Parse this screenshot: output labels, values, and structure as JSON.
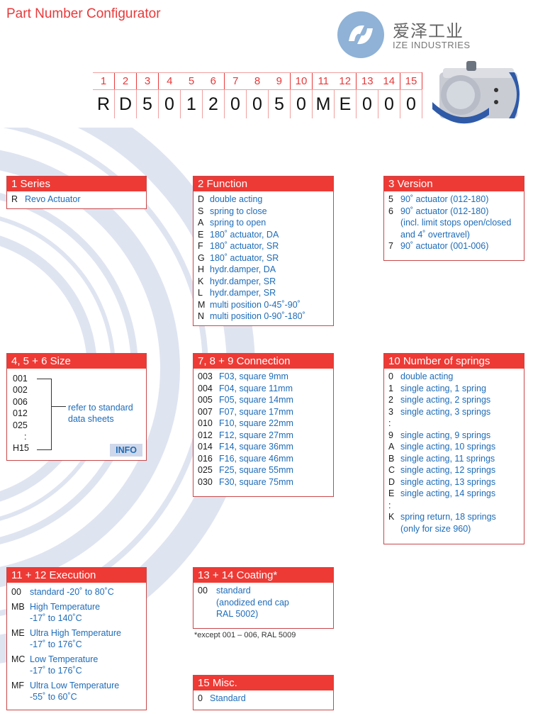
{
  "title": "Part Number Configurator",
  "logo": {
    "chinese": "爱泽工业",
    "english": "IZE INDUSTRIES"
  },
  "code": {
    "positions": [
      "1",
      "2",
      "3",
      "4",
      "5",
      "6",
      "7",
      "8",
      "9",
      "10",
      "11",
      "12",
      "13",
      "14",
      "15"
    ],
    "values": [
      "R",
      "D",
      "5",
      "0",
      "1",
      "2",
      "0",
      "0",
      "5",
      "0",
      "M",
      "E",
      "0",
      "0",
      "0"
    ]
  },
  "series": {
    "header": "1  Series",
    "items": [
      {
        "code": "R",
        "desc": "Revo Actuator"
      }
    ]
  },
  "function": {
    "header": "2  Function",
    "items": [
      {
        "code": "D",
        "desc": "double acting"
      },
      {
        "code": "S",
        "desc": "spring to close"
      },
      {
        "code": "A",
        "desc": "spring to open"
      },
      {
        "code": "E",
        "desc": "180˚ actuator, DA"
      },
      {
        "code": "F",
        "desc": "180˚ actuator, SR"
      },
      {
        "code": "G",
        "desc": "180˚ actuator, SR"
      },
      {
        "code": "H",
        "desc": "hydr.damper, DA"
      },
      {
        "code": "K",
        "desc": "hydr.damper, SR"
      },
      {
        "code": "L",
        "desc": "hydr.damper, SR"
      },
      {
        "code": "M",
        "desc": "multi position 0-45˚-90˚"
      },
      {
        "code": "N",
        "desc": "multi position 0-90˚-180˚"
      }
    ]
  },
  "version": {
    "header": "3  Version",
    "items": [
      {
        "code": "5",
        "desc": "90˚ actuator (012-180)"
      },
      {
        "code": "6",
        "desc": "90˚ actuator (012-180)",
        "extra": [
          "(incl. limit stops open/closed",
          "and 4˚ overtravel)"
        ]
      },
      {
        "code": "7",
        "desc": "90˚ actuator (001-006)"
      }
    ]
  },
  "size": {
    "header": "4, 5 + 6  Size",
    "items": [
      "001",
      "002",
      "006",
      "012",
      "025",
      ":",
      "H15"
    ],
    "reference": [
      "refer to standard",
      "data sheets"
    ],
    "info_label": "INFO"
  },
  "connection": {
    "header": "7, 8 + 9  Connection",
    "items": [
      {
        "code": "003",
        "desc": "F03, square 9mm"
      },
      {
        "code": "004",
        "desc": "F04, square 11mm"
      },
      {
        "code": "005",
        "desc": "F05, square 14mm"
      },
      {
        "code": "007",
        "desc": "F07, square 17mm"
      },
      {
        "code": "010",
        "desc": "F10, square 22mm"
      },
      {
        "code": "012",
        "desc": "F12, square 27mm"
      },
      {
        "code": "014",
        "desc": "F14, square 36mm"
      },
      {
        "code": "016",
        "desc": "F16, square 46mm"
      },
      {
        "code": "025",
        "desc": "F25, square 55mm"
      },
      {
        "code": "030",
        "desc": "F30, square 75mm"
      }
    ]
  },
  "springs": {
    "header": "10  Number of springs",
    "items": [
      {
        "code": "0",
        "desc": "double acting"
      },
      {
        "code": "1",
        "desc": "single acting, 1 spring"
      },
      {
        "code": "2",
        "desc": "single acting, 2 springs"
      },
      {
        "code": "3",
        "desc": "single acting, 3 springs"
      },
      {
        "code": ":",
        "desc": ""
      },
      {
        "code": "9",
        "desc": "single acting, 9 springs"
      },
      {
        "code": "A",
        "desc": "single acting, 10 springs"
      },
      {
        "code": "B",
        "desc": "single acting, 11 springs"
      },
      {
        "code": "C",
        "desc": "single acting, 12 springs"
      },
      {
        "code": "D",
        "desc": "single acting, 13 springs"
      },
      {
        "code": "E",
        "desc": "single acting, 14 springs"
      },
      {
        "code": ":",
        "desc": ""
      },
      {
        "code": "K",
        "desc": "spring return, 18 springs",
        "extra": [
          "(only for size 960)"
        ]
      }
    ]
  },
  "execution": {
    "header": "11 + 12  Execution",
    "items": [
      {
        "code": "00",
        "desc": "standard  -20˚ to 80˚C"
      },
      {
        "code": "MB",
        "desc": "High Temperature",
        "extra": [
          "-17˚ to 140˚C"
        ]
      },
      {
        "code": "ME",
        "desc": "Ultra High Temperature",
        "extra": [
          "-17˚ to 176˚C"
        ]
      },
      {
        "code": "MC",
        "desc": "Low Temperature",
        "extra": [
          "-17˚ to 176˚C"
        ]
      },
      {
        "code": "MF",
        "desc": "Ultra Low Temperature",
        "extra": [
          "-55˚ to 60˚C"
        ]
      }
    ]
  },
  "coating": {
    "header": "13 + 14  Coating*",
    "items": [
      {
        "code": "00",
        "desc": "standard",
        "extra": [
          "(anodized end cap",
          "RAL 5002)"
        ]
      }
    ],
    "footnote": "*except 001 – 006, RAL 5009"
  },
  "misc": {
    "header": "15  Misc.",
    "items": [
      {
        "code": "0",
        "desc": "Standard"
      }
    ]
  },
  "colors": {
    "accent": "#ee3a35",
    "link": "#1e6cb8",
    "info_bg": "#cfd8ea",
    "swirl": "#dfe4f1"
  }
}
